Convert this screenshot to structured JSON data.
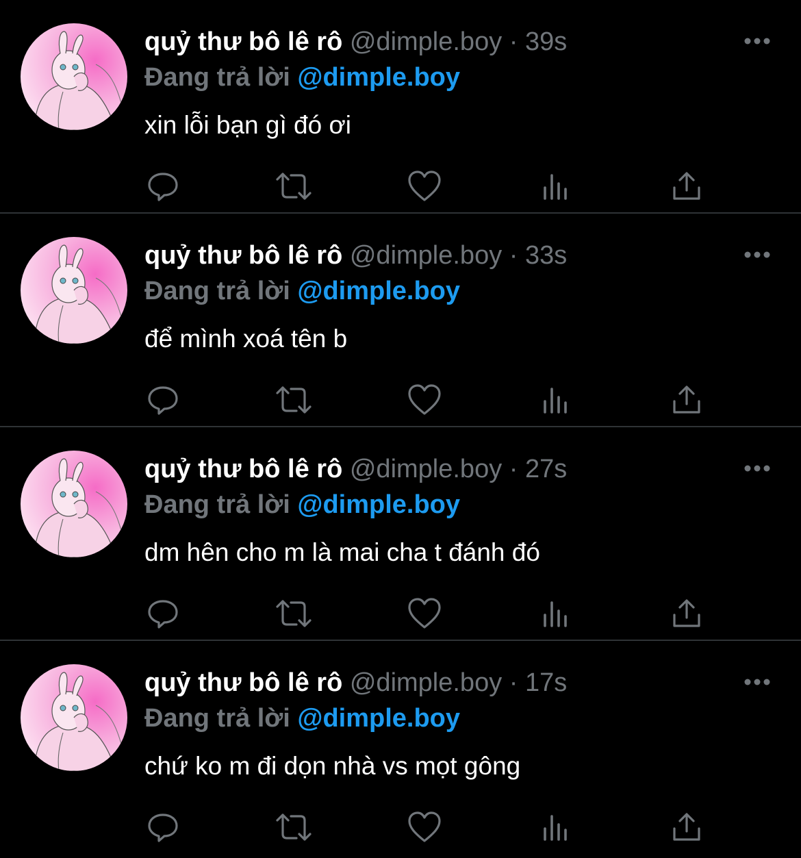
{
  "colors": {
    "background": "#000000",
    "name": "#ffffff",
    "muted": "#71767b",
    "link": "#1d9bf0",
    "divider": "#2f3336"
  },
  "tweets": [
    {
      "name": "quỷ thư bô lê rô",
      "handle": "@dimple.boy",
      "separator": "·",
      "time": "39s",
      "reply_prefix": "Đang trả lời",
      "reply_to": "@dimple.boy",
      "text": "xin lỗi bạn gì đó ơi"
    },
    {
      "name": "quỷ thư bô lê rô",
      "handle": "@dimple.boy",
      "separator": "·",
      "time": "33s",
      "reply_prefix": "Đang trả lời",
      "reply_to": "@dimple.boy",
      "text": "để mình xoá tên b"
    },
    {
      "name": "quỷ thư bô lê rô",
      "handle": "@dimple.boy",
      "separator": "·",
      "time": "27s",
      "reply_prefix": "Đang trả lời",
      "reply_to": "@dimple.boy",
      "text": "dm hên cho m là mai cha t đánh đó"
    },
    {
      "name": "quỷ thư bô lê rô",
      "handle": "@dimple.boy",
      "separator": "·",
      "time": "17s",
      "reply_prefix": "Đang trả lời",
      "reply_to": "@dimple.boy",
      "text": "chứ ko m đi dọn nhà vs mọt gông"
    }
  ],
  "icons": {
    "more": "more-horizontal-icon",
    "reply": "reply-icon",
    "retweet": "retweet-icon",
    "like": "heart-icon",
    "views": "analytics-icon",
    "share": "share-icon",
    "avatar": "bunny-avatar"
  }
}
